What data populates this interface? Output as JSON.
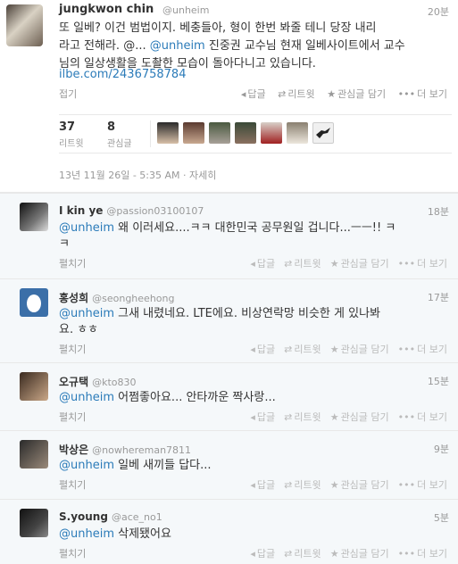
{
  "main": {
    "name": "jungkwon chin",
    "handle": "@unheim",
    "time": "20분",
    "text_lines": [
      "또 일베? 이건 범법이지. 베충들아, 형이 한번 봐줄 테니 당장 내리",
      "라고 전해라.  @... @unheim 진중권 교수님 현재 일베사이트에서 교수",
      "님의 일상생활을 도촬한 모습이 돌아다니고 있습니다."
    ],
    "link": "ilbe.com/2436758784",
    "collapse": "접기",
    "actions": {
      "reply": "답글",
      "retweet": "리트윗",
      "favorite": "관심글 담기",
      "more": "더 보기"
    },
    "retweets": {
      "count": "37",
      "label": "리트윗"
    },
    "favorites": {
      "count": "8",
      "label": "관심글"
    },
    "date": "13년 11월 26일 - 5:35 AM · 자세히",
    "colors": {
      "link": "#2b7bb9",
      "muted": "#999999",
      "reply_bg": "#f5f8fa"
    }
  },
  "replies": [
    {
      "name": "I kin ye",
      "handle": "@passion03100107",
      "time": "18분",
      "mention": "@unheim",
      "lines": [
        " 왜 이러세요....ㅋㅋ 대한민국 공무원일 겁니다...ㅡㅡ!! ㅋ",
        "ㅋ"
      ],
      "expand": "펼치기"
    },
    {
      "name": "홍성희",
      "handle": "@seongheehong",
      "time": "17분",
      "mention": "@unheim",
      "lines": [
        " 그새 내렸네요. LTE에요. 비상연락망 비슷한 게 있나봐",
        "요. ㅎㅎ"
      ],
      "expand": "펼치기"
    },
    {
      "name": "오규택",
      "handle": "@kto830",
      "time": "15분",
      "mention": "@unheim",
      "lines": [
        " 어쩜좋아요... 안타까운 짝사랑..."
      ],
      "expand": "펼치기"
    },
    {
      "name": "박상은",
      "handle": "@nowhereman7811",
      "time": "9분",
      "mention": "@unheim",
      "lines": [
        " 일베 새끼들 답다..."
      ],
      "expand": "펼치기"
    },
    {
      "name": "S.young",
      "handle": "@ace_no1",
      "time": "5분",
      "mention": "@unheim",
      "lines": [
        " 삭제됐어요"
      ],
      "expand": "펼치기"
    }
  ],
  "reply_actions": {
    "reply": "답글",
    "retweet": "리트윗",
    "favorite": "관심글 담기",
    "more": "더 보기"
  }
}
